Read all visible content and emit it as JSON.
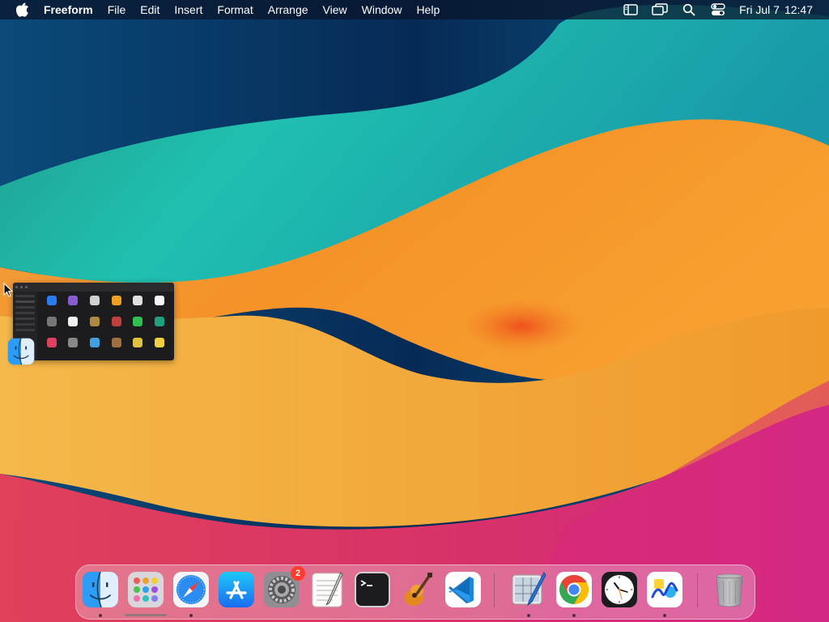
{
  "menubar": {
    "app_name": "Freeform",
    "menus": [
      "File",
      "Edit",
      "Insert",
      "Format",
      "Arrange",
      "View",
      "Window",
      "Help"
    ],
    "clock_date": "Fri Jul 7",
    "clock_time": "12:47",
    "status_icons": [
      "sidebar-icon",
      "screen-mirroring-icon",
      "spotlight-search-icon",
      "control-center-icon"
    ]
  },
  "dock": {
    "items": [
      {
        "name": "Finder",
        "icon": "finder-icon",
        "running": true
      },
      {
        "name": "Launchpad",
        "icon": "launchpad-icon",
        "running": false
      },
      {
        "name": "Safari",
        "icon": "safari-icon",
        "running": true
      },
      {
        "name": "App Store",
        "icon": "app-store-icon",
        "running": false
      },
      {
        "name": "System Settings",
        "icon": "system-settings-icon",
        "running": false,
        "badge": "2"
      },
      {
        "name": "TextEdit",
        "icon": "textedit-icon",
        "running": false
      },
      {
        "name": "Terminal",
        "icon": "terminal-icon",
        "running": false
      },
      {
        "name": "GarageBand",
        "icon": "garageband-icon",
        "running": false
      },
      {
        "name": "Visual Studio Code",
        "icon": "vscode-icon",
        "running": false
      },
      {
        "name": "Preview",
        "icon": "preview-icon",
        "running": true
      },
      {
        "name": "Google Chrome",
        "icon": "chrome-icon",
        "running": true
      },
      {
        "name": "Clock",
        "icon": "clock-icon",
        "running": false
      },
      {
        "name": "Freeform",
        "icon": "freeform-icon",
        "running": true
      },
      {
        "name": "Trash",
        "icon": "trash-icon",
        "running": false
      }
    ]
  },
  "colors": {
    "wallpaper_navy": "#0a2a55",
    "wallpaper_teal": "#1ab5a8",
    "wallpaper_orange": "#f5922a",
    "wallpaper_pink": "#e0357a",
    "badge_red": "#ff3b30"
  }
}
